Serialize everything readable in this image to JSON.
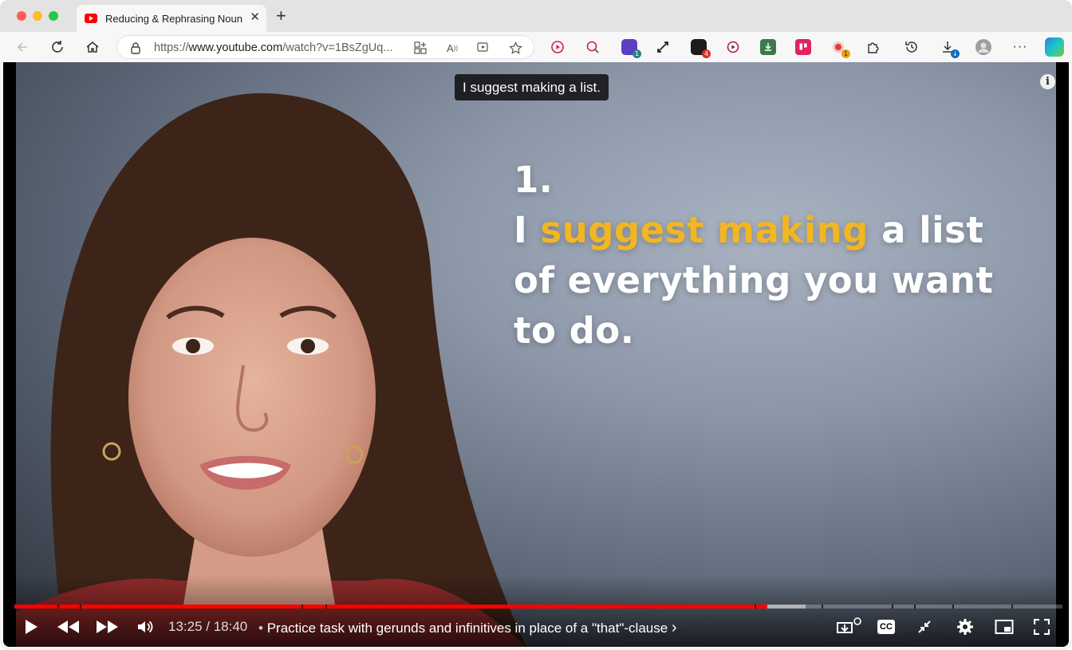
{
  "browser": {
    "tab_title": "Reducing & Rephrasing Noun Cl",
    "url_prefix": "https://",
    "url_domain": "www.youtube.com",
    "url_path": "/watch?v=1BsZgUq...",
    "extension_badges": [
      "1",
      "4",
      "1",
      "↓"
    ]
  },
  "video": {
    "caption": "I suggest making a list.",
    "slide": {
      "number": "1.",
      "line1_pre": "I ",
      "line1_highlight": "suggest making",
      "line1_post": " a list",
      "line2": "of everything you want",
      "line3": "to do."
    },
    "controls": {
      "time_current": "13:25",
      "time_separator": " / ",
      "time_total": "18:40",
      "chapter_bullet": "•",
      "chapter_title": "Practice task with gerunds and infinitives in place of a \"that\"-clause",
      "chapter_chevron": "›",
      "cc_label": "CC"
    },
    "progress": {
      "played": 0.7184,
      "buffered": 0.755
    }
  },
  "colors": {
    "accent": "#ff0000",
    "highlight": "#f2b623"
  }
}
